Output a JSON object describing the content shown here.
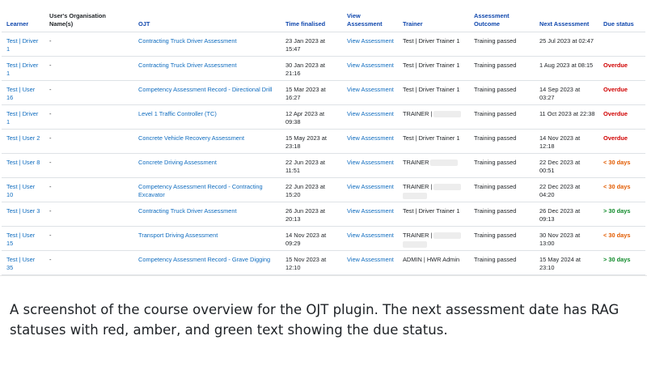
{
  "table": {
    "headers": {
      "learner": "Learner",
      "org": "User's Organisation Name(s)",
      "ojt": "OJT",
      "time_finalised": "Time finalised",
      "view_assessment": "View Assessment",
      "trainer": "Trainer",
      "outcome": "Assessment Outcome",
      "next_assessment": "Next Assessment",
      "due_status": "Due status"
    },
    "rows": [
      {
        "learner": "Test | Driver 1",
        "org": "-",
        "ojt": "Contracting Truck Driver Assessment",
        "time": "23 Jan 2023 at 15:47",
        "view": "View Assessment",
        "trainer": "Test | Driver Trainer 1",
        "outcome": "Training passed",
        "next": "25 Jul 2023 at 02:47",
        "due": ""
      },
      {
        "learner": "Test | Driver 1",
        "org": "-",
        "ojt": "Contracting Truck Driver Assessment",
        "time": "30 Jan 2023 at 21:16",
        "view": "View Assessment",
        "trainer": "Test | Driver Trainer 1",
        "outcome": "Training passed",
        "next": "1 Aug 2023 at 08:15",
        "due": "Overdue"
      },
      {
        "learner": "Test | User 16",
        "org": "-",
        "ojt": "Competency Assessment Record - Directional Drill",
        "time": "15 Mar 2023 at 16:27",
        "view": "View Assessment",
        "trainer": "Test | Driver Trainer 1",
        "outcome": "Training passed",
        "next": "14 Sep 2023 at 03:27",
        "due": "Overdue"
      },
      {
        "learner": "Test | Driver 1",
        "org": "-",
        "ojt": "Level 1 Traffic Controller (TC)",
        "time": "12 Apr 2023 at 09:38",
        "view": "View Assessment",
        "trainer": "TRAINER |",
        "outcome": "Training passed",
        "next": "11 Oct 2023 at 22:38",
        "due": "Overdue"
      },
      {
        "learner": "Test | User 2",
        "org": "-",
        "ojt": "Concrete Vehicle Recovery Assessment",
        "time": "15 May 2023 at 23:18",
        "view": "View Assessment",
        "trainer": "Test | Driver Trainer 1",
        "outcome": "Training passed",
        "next": "14 Nov 2023 at 12:18",
        "due": "Overdue"
      },
      {
        "learner": "Test | User 8",
        "org": "-",
        "ojt": "Concrete Driving Assessment",
        "time": "22 Jun 2023 at 11:51",
        "view": "View Assessment",
        "trainer": "TRAINER",
        "outcome": "Training passed",
        "next": "22 Dec 2023 at 00:51",
        "due": "< 30 days"
      },
      {
        "learner": "Test | User 10",
        "org": "-",
        "ojt": "Competency Assessment Record - Contracting Excavator",
        "time": "22 Jun 2023 at 15:20",
        "view": "View Assessment",
        "trainer": "TRAINER |",
        "outcome": "Training passed",
        "next": "22 Dec 2023 at 04:20",
        "due": "< 30 days"
      },
      {
        "learner": "Test | User 3",
        "org": "-",
        "ojt": "Contracting Truck Driver Assessment",
        "time": "26 Jun 2023 at 20:13",
        "view": "View Assessment",
        "trainer": "Test | Driver Trainer 1",
        "outcome": "Training passed",
        "next": "26 Dec 2023 at 09:13",
        "due": "> 30 days"
      },
      {
        "learner": "Test | User 15",
        "org": "-",
        "ojt": "Transport Driving Assessment",
        "time": "14 Nov 2023 at 09:29",
        "view": "View Assessment",
        "trainer": "TRAINER |",
        "outcome": "Training passed",
        "next": "30 Nov 2023 at 13:00",
        "due": "< 30 days"
      },
      {
        "learner": "Test | User 35",
        "org": "-",
        "ojt": "Competency Assessment Record - Grave Digging",
        "time": "15 Nov 2023 at 12:10",
        "view": "View Assessment",
        "trainer": "ADMIN | HWR Admin",
        "outcome": "Training passed",
        "next": "15 May 2024 at 23:10",
        "due": "> 30 days"
      }
    ]
  },
  "due_colors": {
    "Overdue": "#d00000",
    "< 30 days": "#e25b00",
    "> 30 days": "#0f8a2a"
  },
  "caption": "A screenshot of the course overview for the OJT plugin. The next assessment date has RAG statuses with red, amber, and green text showing the due status."
}
